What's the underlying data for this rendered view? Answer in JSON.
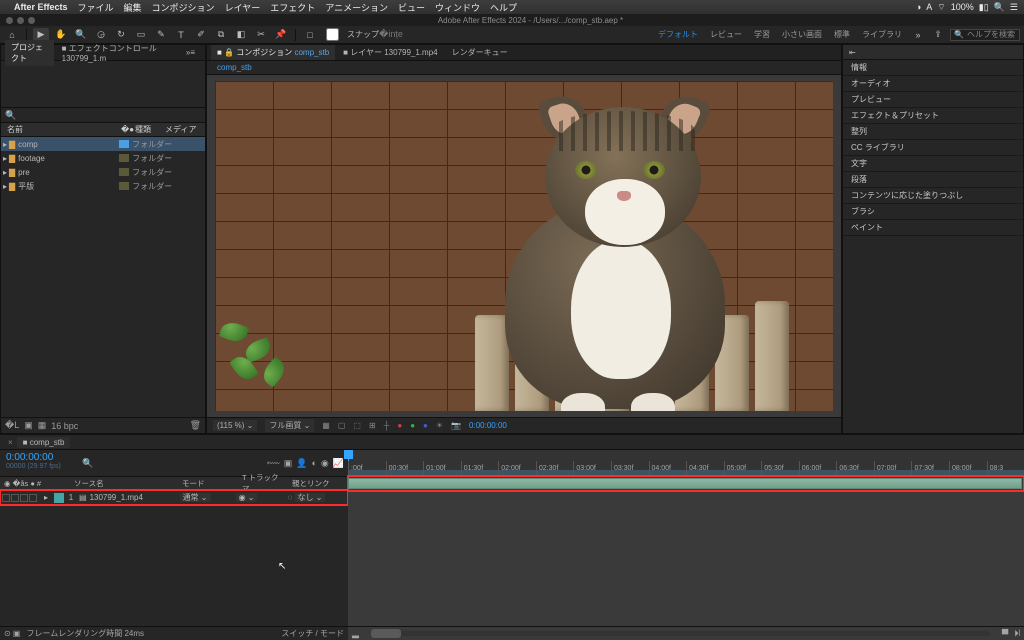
{
  "mac_menu": {
    "app": "After Effects",
    "items": [
      "ファイル",
      "編集",
      "コンポジション",
      "レイヤー",
      "エフェクト",
      "アニメーション",
      "ビュー",
      "ウィンドウ",
      "ヘルプ"
    ],
    "wifi": "⌔",
    "battery": "100%",
    "ime": "A"
  },
  "window": {
    "title": "Adobe After Effects 2024 - /Users/.../comp_stb.aep *"
  },
  "toolbar": {
    "snap_label": "スナップ",
    "workspaces": {
      "default": "デフォルト",
      "review": "レビュー",
      "learn": "学習",
      "small": "小さい画面",
      "standard": "標準",
      "library": "ライブラリ"
    },
    "search_placeholder": "ヘルプを検索"
  },
  "project_panel": {
    "tabs": {
      "project": "プロジェクト",
      "effect_controls": "エフェクトコントロール 130799_1.m"
    },
    "columns": {
      "name": "名前",
      "kind": "種類",
      "media": "メディア"
    },
    "items": [
      {
        "name": "comp",
        "kind": "フォルダー",
        "selected": true
      },
      {
        "name": "footage",
        "kind": "フォルダー"
      },
      {
        "name": "pre",
        "kind": "フォルダー"
      },
      {
        "name": "平版",
        "kind": "フォルダー"
      }
    ],
    "bpc": "16 bpc"
  },
  "comp_panel": {
    "tabs": {
      "composition": "コンポジション",
      "comp_name": "comp_stb",
      "layer": "レイヤー 130799_1.mp4",
      "render_queue": "レンダーキュー"
    },
    "breadcrumb": "comp_stb",
    "footer": {
      "mag": "(115 %)",
      "res": "フル画質",
      "timecode": "0:00:00:00"
    }
  },
  "right_panels": {
    "items": [
      "情報",
      "オーディオ",
      "プレビュー",
      "エフェクト＆プリセット",
      "整列",
      "CC ライブラリ",
      "文字",
      "段落",
      "コンテンツに応じた塗りつぶし",
      "ブラシ",
      "ペイント"
    ]
  },
  "timeline": {
    "tab": "comp_stb",
    "timecode": "0:00:00:00",
    "timecode_sub": "00000 (29.97 fps)",
    "columns": {
      "source": "ソース名",
      "mode": "モード",
      "trkmat": "T  トラックマ",
      "parent": "親とリンク"
    },
    "layer": {
      "index": "1",
      "name": "130799_1.mp4",
      "mode": "通常",
      "parent": "なし"
    },
    "ruler": [
      ":00f",
      "00:30f",
      "01:00f",
      "01:30f",
      "02:00f",
      "02:30f",
      "03:00f",
      "03:30f",
      "04:00f",
      "04:30f",
      "05:00f",
      "05:30f",
      "06:00f",
      "06:30f",
      "07:00f",
      "07:30f",
      "08:00f",
      "08:3"
    ],
    "footer": {
      "frame_render": "フレームレンダリング時間  24ms",
      "switches": "スイッチ / モード"
    }
  }
}
